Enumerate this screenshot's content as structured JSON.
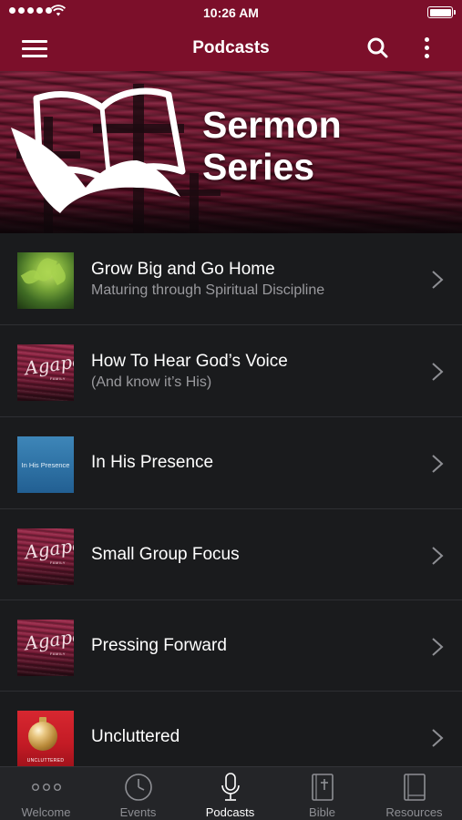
{
  "status_bar": {
    "time": "10:26 AM",
    "signal_bars": 5,
    "battery_level": 1.0
  },
  "nav": {
    "title": "Podcasts",
    "menu_icon": "hamburger-icon",
    "search_icon": "search-icon",
    "more_icon": "more-vertical-icon"
  },
  "banner": {
    "line1": "Sermon",
    "line2": "Series"
  },
  "podcasts": [
    {
      "title": "Grow Big and Go Home",
      "subtitle": "Maturing through Spiritual Discipline",
      "thumb": "green"
    },
    {
      "title": "How To Hear God’s Voice",
      "subtitle": "(And know it’s His)",
      "thumb": "agape"
    },
    {
      "title": "In His Presence",
      "subtitle": "",
      "thumb": "blue",
      "thumb_text": "In His Presence"
    },
    {
      "title": "Small Group Focus",
      "subtitle": "",
      "thumb": "agape"
    },
    {
      "title": "Pressing Forward",
      "subtitle": "",
      "thumb": "agape"
    },
    {
      "title": "Uncluttered",
      "subtitle": "",
      "thumb": "red",
      "thumb_text": "UNCLUTTERED"
    }
  ],
  "tabs": [
    {
      "label": "Welcome",
      "icon": "ellipsis-icon",
      "active": false
    },
    {
      "label": "Events",
      "icon": "clock-icon",
      "active": false
    },
    {
      "label": "Podcasts",
      "icon": "microphone-icon",
      "active": true
    },
    {
      "label": "Bible",
      "icon": "bible-icon",
      "active": false
    },
    {
      "label": "Resources",
      "icon": "book-icon",
      "active": false
    }
  ],
  "colors": {
    "brand": "#7c0f2a",
    "background": "#1a1b1d",
    "tab_bar": "#242528",
    "active_tab": "#ffffff",
    "inactive_tab": "#8e8f94"
  }
}
